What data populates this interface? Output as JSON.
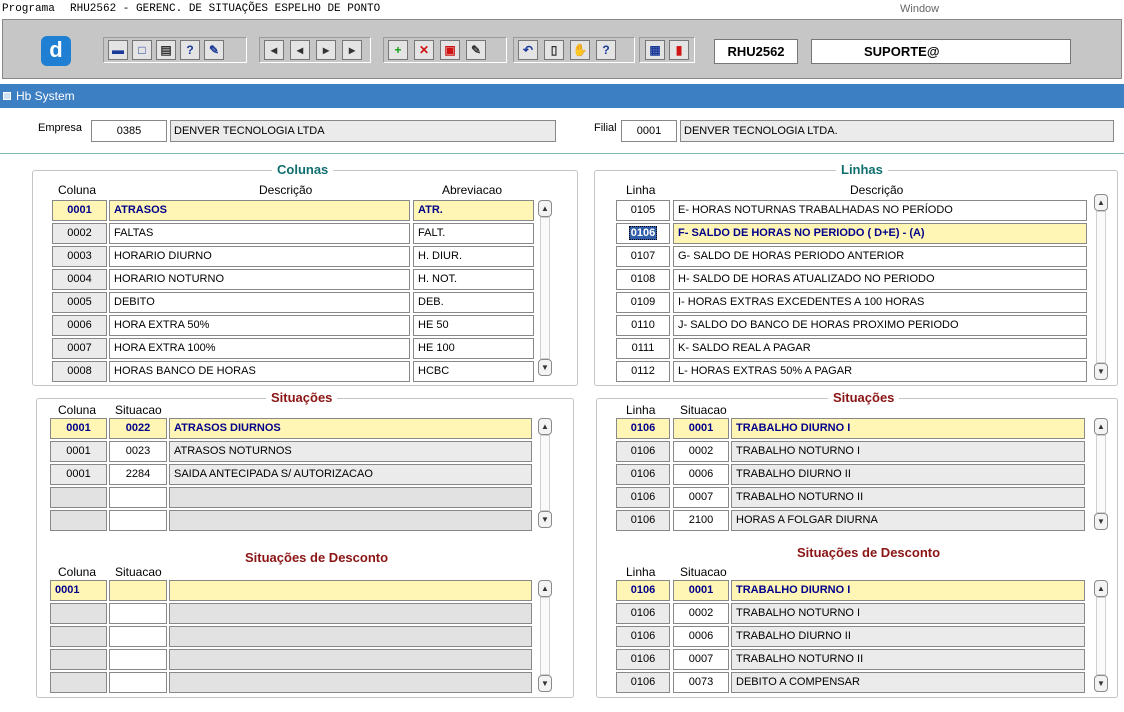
{
  "menubar": {
    "program_menu": "Programa",
    "program_title": "RHU2562 - GERENC. DE SITUAÇÕES ESPELHO DE PONTO",
    "window_menu": "Window"
  },
  "toolbar": {
    "logo": "d",
    "buttons": [
      {
        "name": "save",
        "glyph": "▬"
      },
      {
        "name": "window",
        "glyph": "□"
      },
      {
        "name": "print",
        "glyph": "▤"
      },
      {
        "name": "help-query",
        "glyph": "?"
      },
      {
        "name": "wizard",
        "glyph": "✎"
      },
      {
        "name": "first-record",
        "glyph": "◂"
      },
      {
        "name": "previous-record",
        "glyph": "◂"
      },
      {
        "name": "next-record",
        "glyph": "▸"
      },
      {
        "name": "last-record",
        "glyph": "▸"
      },
      {
        "name": "insert-record",
        "glyph": "+"
      },
      {
        "name": "delete-record",
        "glyph": "✕"
      },
      {
        "name": "clear-record",
        "glyph": "▣"
      },
      {
        "name": "edit",
        "glyph": "✎"
      },
      {
        "name": "undo",
        "glyph": "↶"
      },
      {
        "name": "copy",
        "glyph": "▯"
      },
      {
        "name": "tools",
        "glyph": "✋"
      },
      {
        "name": "help",
        "glyph": "?"
      },
      {
        "name": "menu",
        "glyph": "▦"
      },
      {
        "name": "exit",
        "glyph": "▮"
      }
    ],
    "program_code": "RHU2562",
    "user": "SUPORTE@"
  },
  "titlebar": {
    "title": "Hb System"
  },
  "header": {
    "empresa_label": "Empresa",
    "empresa_code": "0385",
    "empresa_name": "DENVER TECNOLOGIA LTDA",
    "filial_label": "Filial",
    "filial_code": "0001",
    "filial_name": "DENVER TECNOLOGIA LTDA."
  },
  "colunas": {
    "title": "Colunas",
    "headers": [
      "Coluna",
      "Descrição",
      "Abreviacao"
    ],
    "rows": [
      [
        "0001",
        "ATRASOS",
        "ATR."
      ],
      [
        "0002",
        "FALTAS",
        "FALT."
      ],
      [
        "0003",
        "HORARIO DIURNO",
        "H. DIUR."
      ],
      [
        "0004",
        "HORARIO NOTURNO",
        "H. NOT."
      ],
      [
        "0005",
        "DEBITO",
        "DEB."
      ],
      [
        "0006",
        "HORA EXTRA 50%",
        "HE 50"
      ],
      [
        "0007",
        "HORA EXTRA 100%",
        "HE 100"
      ],
      [
        "0008",
        "HORAS BANCO DE HORAS",
        "HCBC"
      ]
    ]
  },
  "linhas": {
    "title": "Linhas",
    "headers": [
      "Linha",
      "Descrição"
    ],
    "rows": [
      [
        "0105",
        "E- HORAS NOTURNAS TRABALHADAS NO PERÍODO"
      ],
      [
        "0106",
        "F- SALDO DE HORAS NO PERIODO ( D+E) - (A)"
      ],
      [
        "0107",
        "G- SALDO DE HORAS PERIODO ANTERIOR"
      ],
      [
        "0108",
        "H- SALDO DE HORAS ATUALIZADO NO PERIODO"
      ],
      [
        "0109",
        "I- HORAS EXTRAS EXCEDENTES A 100 HORAS"
      ],
      [
        "0110",
        "J- SALDO DO BANCO DE HORAS PROXIMO PERIODO"
      ],
      [
        "0111",
        "K- SALDO REAL A PAGAR"
      ],
      [
        "0112",
        "L- HORAS EXTRAS 50% A PAGAR"
      ]
    ]
  },
  "col_situacoes": {
    "title": "Situações",
    "headers": [
      "Coluna",
      "Situacao"
    ],
    "rows": [
      [
        "0001",
        "0022",
        "ATRASOS DIURNOS"
      ],
      [
        "0001",
        "0023",
        "ATRASOS NOTURNOS"
      ],
      [
        "0001",
        "2284",
        "SAIDA ANTECIPADA S/ AUTORIZACAO"
      ],
      [
        "",
        "",
        ""
      ],
      [
        "",
        "",
        ""
      ]
    ]
  },
  "lin_situacoes": {
    "title": "Situações",
    "headers": [
      "Linha",
      "Situacao"
    ],
    "rows": [
      [
        "0106",
        "0001",
        "TRABALHO DIURNO I"
      ],
      [
        "0106",
        "0002",
        "TRABALHO NOTURNO I"
      ],
      [
        "0106",
        "0006",
        "TRABALHO DIURNO II"
      ],
      [
        "0106",
        "0007",
        "TRABALHO NOTURNO II"
      ],
      [
        "0106",
        "2100",
        "HORAS A FOLGAR DIURNA"
      ]
    ]
  },
  "col_desconto": {
    "title": "Situações de Desconto",
    "headers": [
      "Coluna",
      "Situacao"
    ],
    "rows": [
      [
        "0001",
        "",
        ""
      ],
      [
        "",
        "",
        ""
      ],
      [
        "",
        "",
        ""
      ],
      [
        "",
        "",
        ""
      ],
      [
        "",
        "",
        ""
      ]
    ]
  },
  "lin_desconto": {
    "title": "Situações de Desconto",
    "headers": [
      "Linha",
      "Situacao"
    ],
    "rows": [
      [
        "0106",
        "0001",
        "TRABALHO DIURNO I"
      ],
      [
        "0106",
        "0002",
        "TRABALHO NOTURNO I"
      ],
      [
        "0106",
        "0006",
        "TRABALHO DIURNO II"
      ],
      [
        "0106",
        "0007",
        "TRABALHO NOTURNO II"
      ],
      [
        "0106",
        "0073",
        "DEBITO A COMPENSAR"
      ]
    ]
  }
}
